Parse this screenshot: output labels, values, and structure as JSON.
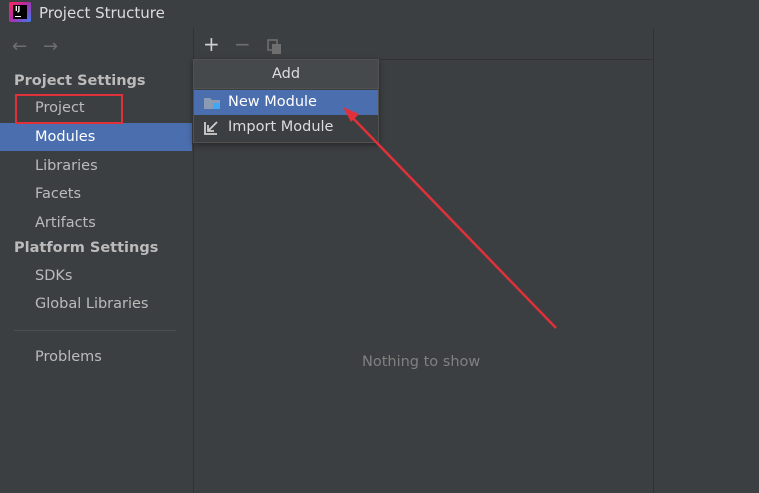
{
  "window": {
    "title": "Project Structure",
    "app_icon_text": "IJ"
  },
  "nav": {
    "back_icon": "←",
    "forward_icon": "→"
  },
  "sidebar": {
    "project_settings_header": "Project Settings",
    "project_settings_items": [
      {
        "label": "Project"
      },
      {
        "label": "Modules"
      },
      {
        "label": "Libraries"
      },
      {
        "label": "Facets"
      },
      {
        "label": "Artifacts"
      }
    ],
    "platform_settings_header": "Platform Settings",
    "platform_settings_items": [
      {
        "label": "SDKs"
      },
      {
        "label": "Global Libraries"
      }
    ],
    "problems_label": "Problems",
    "selected_item": "Modules"
  },
  "toolbar": {
    "add_icon": "+",
    "remove_icon": "−",
    "copy_icon": "copy-icon"
  },
  "popup": {
    "header": "Add",
    "items": [
      {
        "label": "New Module",
        "icon": "folder-module-icon"
      },
      {
        "label": "Import Module",
        "icon": "import-arrow-icon"
      }
    ]
  },
  "main": {
    "empty_text": "Nothing to show"
  },
  "colors": {
    "background": "#3c3f41",
    "selection": "#4b6eaf",
    "annotation_red": "#e0303a"
  }
}
